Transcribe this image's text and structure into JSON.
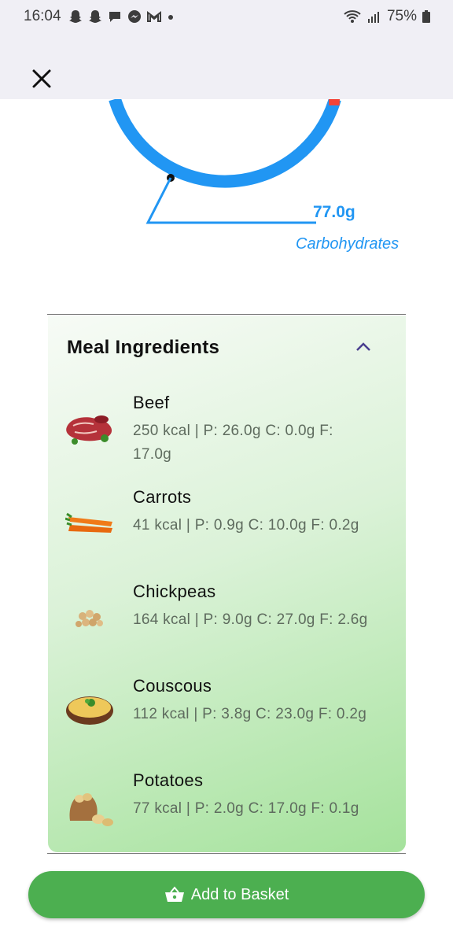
{
  "status_bar": {
    "time": "16:04",
    "battery": "75%",
    "notification_icons": [
      "snapchat-icon",
      "snapchat-icon",
      "chat-icon",
      "messenger-icon",
      "gmail-icon",
      "dot-icon"
    ]
  },
  "header": {
    "close_icon": "close-icon"
  },
  "macro_chart": {
    "value": "77.0g",
    "label": "Carbohydrates",
    "colors": {
      "carbs": "#2196f3",
      "other": "#f44336"
    }
  },
  "ingredients": {
    "title": "Meal Ingredients",
    "expanded": true,
    "items": [
      {
        "name": "Beef",
        "macros": "250 kcal | P: 26.0g C: 0.0g F: 17.0g",
        "image": "beef"
      },
      {
        "name": "Carrots",
        "macros": "41 kcal | P: 0.9g C: 10.0g F: 0.2g",
        "image": "carrots"
      },
      {
        "name": "Chickpeas",
        "macros": "164 kcal | P: 9.0g C: 27.0g F: 2.6g",
        "image": "chickpeas"
      },
      {
        "name": "Couscous",
        "macros": "112 kcal | P: 3.8g C: 23.0g F: 0.2g",
        "image": "couscous"
      },
      {
        "name": "Potatoes",
        "macros": "77 kcal | P: 2.0g C: 17.0g F: 0.1g",
        "image": "potatoes"
      }
    ]
  },
  "actions": {
    "add_to_basket": "Add to Basket",
    "accent_color": "#4caf50"
  }
}
